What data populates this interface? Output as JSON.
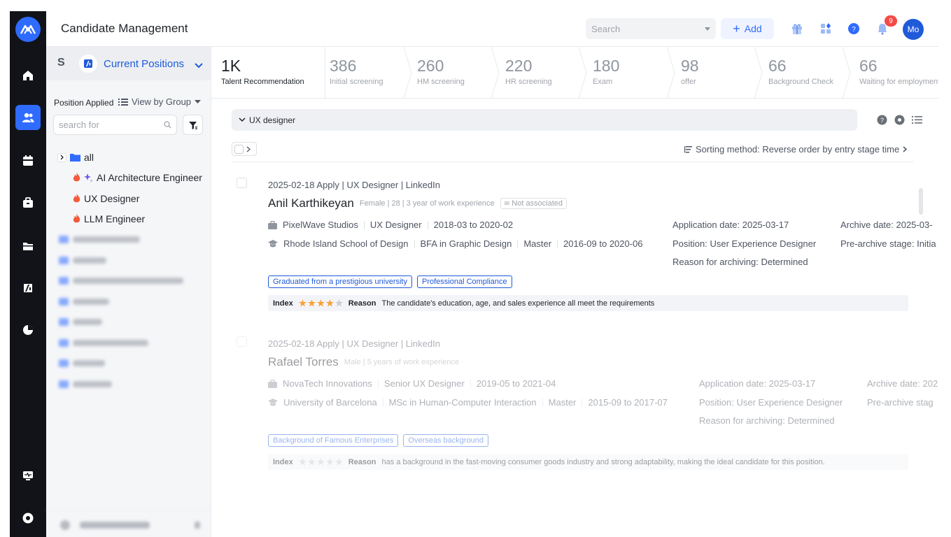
{
  "header": {
    "title": "Candidate Management",
    "search_placeholder": "Search",
    "add_label": "Add",
    "notification_count": "9",
    "avatar_initials": "Mo"
  },
  "sidebar": {
    "current_positions": "Current Positions",
    "position_applied": "Position Applied",
    "view_by_group": "View by Group",
    "search_placeholder": "search for",
    "tree": {
      "root": "all",
      "items": [
        "AI Architecture Engineer",
        "UX Designer",
        "LLM Engineer"
      ]
    }
  },
  "stages": [
    {
      "count": "1K",
      "label": "Talent Recommendation",
      "active": true
    },
    {
      "count": "386",
      "label": "Initial screening"
    },
    {
      "count": "260",
      "label": "HM screening"
    },
    {
      "count": "220",
      "label": "HR screening"
    },
    {
      "count": "180",
      "label": "Exam"
    },
    {
      "count": "98",
      "label": "offer"
    },
    {
      "count": "66",
      "label": "Background Check"
    },
    {
      "count": "66",
      "label": "Waiting for employment"
    }
  ],
  "group": {
    "label": "UX designer"
  },
  "sorting": {
    "label": "Sorting method: Reverse order by entry stage time"
  },
  "candidates": [
    {
      "meta": "2025-02-18 Apply | UX Designer | LinkedIn",
      "name": "Anil Karthikeyan",
      "details": "Female | 28 | 3 year of work experience",
      "association": "Not associated",
      "work": [
        "PixelWave Studios",
        "UX Designer",
        "2018-03 to 2020-02"
      ],
      "education": [
        "Rhode Island School of Design",
        "BFA in Graphic Design",
        "Master",
        "2016-09 to 2020-06"
      ],
      "application_date": "Application date: 2025-03-17",
      "position": "Position: User Experience Designer",
      "reason_archiving": "Reason for archiving: Determined",
      "archive_date": "Archive date: 2025-03-",
      "pre_archive": "Pre-archive stage: Initia",
      "tags": [
        "Graduated from a prestigious university",
        "Professional Compliance"
      ],
      "index_label": "Index",
      "stars": 4,
      "reason_label": "Reason",
      "reason": "The candidate's education, age, and sales experience all meet the requirements"
    },
    {
      "meta": "2025-02-18 Apply | UX Designer | LinkedIn",
      "name": "Rafael Torres",
      "details": "Male | 5 years of work experience",
      "work": [
        "NovaTech Innovations",
        "Senior UX Designer",
        "2019-05 to 2021-04"
      ],
      "education": [
        "University of Barcelona",
        "MSc in Human-Computer Interaction",
        "Master",
        "2015-09 to 2017-07"
      ],
      "application_date": "Application date: 2025-03-17",
      "position": "Position: User Experience Designer",
      "reason_archiving": "Reason for archiving: Determined",
      "archive_date": "Archive date: 202",
      "pre_archive": "Pre-archive stag",
      "tags": [
        "Background of Famous Enterprises",
        "Overseas background"
      ],
      "index_label": "Index",
      "stars": 0,
      "reason_label": "Reason",
      "reason": "has a background in the fast-moving consumer goods industry and strong adaptability, making the ideal candidate for this position."
    }
  ],
  "colors": {
    "accent": "#2f6bff",
    "rail": "#111318",
    "flame": "#f25a3b",
    "star": "#f7a13a"
  }
}
